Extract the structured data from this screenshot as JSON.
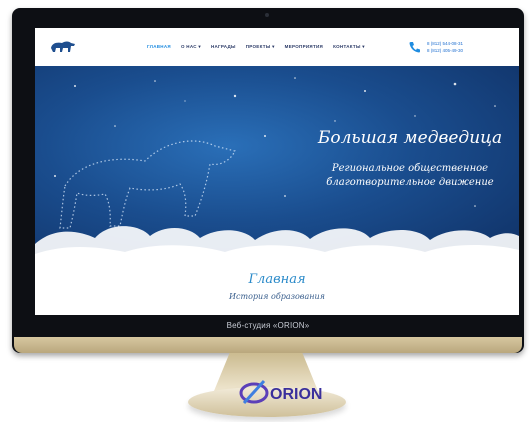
{
  "header": {
    "logo_icon": "polar-bear-logo",
    "nav": [
      {
        "label": "ГЛАВНАЯ",
        "active": true
      },
      {
        "label": "О НАС ▾",
        "active": false
      },
      {
        "label": "НАГРАДЫ",
        "active": false
      },
      {
        "label": "ПРОЕКТЫ ▾",
        "active": false
      },
      {
        "label": "МЕРОПРИЯТИЯ",
        "active": false
      },
      {
        "label": "КОНТАКТЫ ▾",
        "active": false
      }
    ],
    "phone_icon": "phone-icon",
    "phone_1": "8 (812) 544-08-31",
    "phone_2": "8 (812) 405-49-30"
  },
  "hero": {
    "title": "Большая медведица",
    "subtitle_line1": "Региональное общественное",
    "subtitle_line2": "благотворительное движение"
  },
  "content": {
    "title": "Главная",
    "subtitle": "История образования"
  },
  "monitor": {
    "brand_label": "Веб-студия «ORION»",
    "stand_logo_text": "ORION",
    "accent_color": "#1f8ce0",
    "sky_color": "#1a4d8e"
  }
}
